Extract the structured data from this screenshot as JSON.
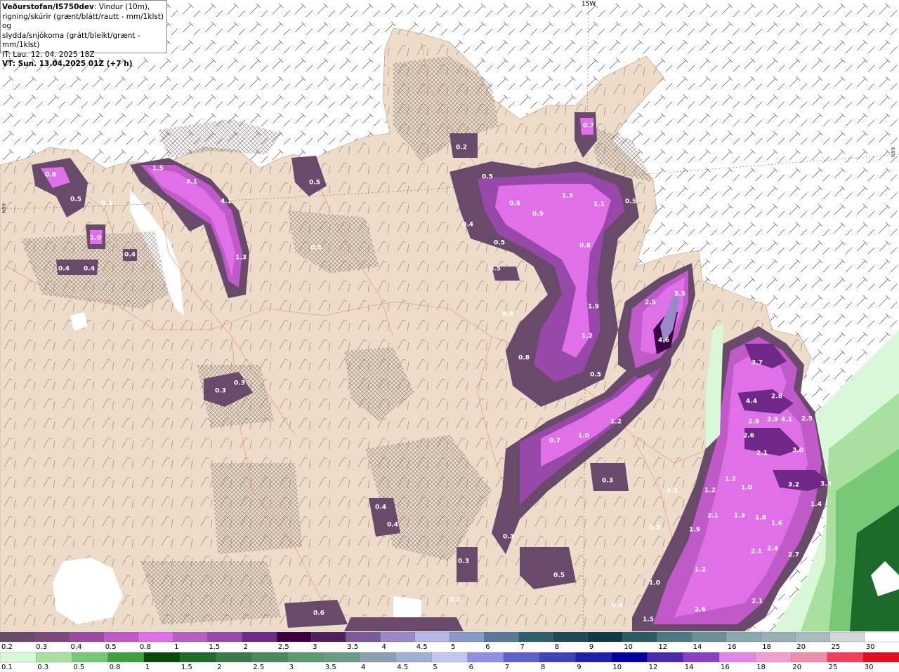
{
  "header": {
    "org": "Veðurstofan/IS750dev",
    "description_l1": ": Vindur (10m),",
    "description_l2": "rigning/skúrir (grænt/blátt/rautt - mm/1klst) og",
    "description_l3": "slydda/snjókoma (grátt/bleikt/grænt - mm/1klst)",
    "init_time": "IT: Lau. 12. 04. 2025 18Z",
    "valid_time": "VT: Sun. 13.04.2025 01Z (+7 h)"
  },
  "grid_labels": {
    "lon_15w": "15W",
    "lat_66n_left": "N99",
    "lat_66n_right": "N99"
  },
  "precip_labels": [
    {
      "text": "0.8"
    },
    {
      "text": "0.5"
    },
    {
      "text": "0.4"
    },
    {
      "text": "1.0"
    },
    {
      "text": "0.4"
    },
    {
      "text": "0.4"
    },
    {
      "text": "0.4"
    },
    {
      "text": "1.5"
    },
    {
      "text": "3.1"
    },
    {
      "text": "4.1"
    },
    {
      "text": "1.3"
    },
    {
      "text": "0.5"
    },
    {
      "text": "0.5"
    },
    {
      "text": "0.3"
    },
    {
      "text": "0.3"
    },
    {
      "text": "0.2"
    },
    {
      "text": "0.7"
    },
    {
      "text": "0.5"
    },
    {
      "text": "0.5"
    },
    {
      "text": "0.9"
    },
    {
      "text": "1.3"
    },
    {
      "text": "1.1"
    },
    {
      "text": "0.5"
    },
    {
      "text": "0.4"
    },
    {
      "text": "0.5"
    },
    {
      "text": "0.8"
    },
    {
      "text": "0.5"
    },
    {
      "text": "1.9"
    },
    {
      "text": "0.4"
    },
    {
      "text": "1.2"
    },
    {
      "text": "0.8"
    },
    {
      "text": "0.5"
    },
    {
      "text": "2.5"
    },
    {
      "text": "5.5"
    },
    {
      "text": "4.6"
    },
    {
      "text": "1.2"
    },
    {
      "text": "0.7"
    },
    {
      "text": "1.0"
    },
    {
      "text": "3.7"
    },
    {
      "text": "4.4"
    },
    {
      "text": "2.8"
    },
    {
      "text": "2.9"
    },
    {
      "text": "3.9"
    },
    {
      "text": "4.1"
    },
    {
      "text": "2.5"
    },
    {
      "text": "2.6"
    },
    {
      "text": "2.1"
    },
    {
      "text": "3.0"
    },
    {
      "text": "1.2"
    },
    {
      "text": "1.0"
    },
    {
      "text": "3.2"
    },
    {
      "text": "3.3"
    },
    {
      "text": "1.4"
    },
    {
      "text": "0.3"
    },
    {
      "text": "0.3"
    },
    {
      "text": "1.2"
    },
    {
      "text": "2.1"
    },
    {
      "text": "1.3"
    },
    {
      "text": "1.8"
    },
    {
      "text": "1.6"
    },
    {
      "text": "1.9"
    },
    {
      "text": "2.1"
    },
    {
      "text": "2.4"
    },
    {
      "text": "2.7"
    },
    {
      "text": "0.4"
    },
    {
      "text": "0.4"
    },
    {
      "text": "0.3"
    },
    {
      "text": "0.3"
    },
    {
      "text": "0.5"
    },
    {
      "text": "1.2"
    },
    {
      "text": "1.0"
    },
    {
      "text": "2.1"
    },
    {
      "text": "0.2"
    },
    {
      "text": "0.4"
    },
    {
      "text": "2.6"
    },
    {
      "text": "1.5"
    },
    {
      "text": "0.6"
    },
    {
      "text": "0.3"
    }
  ],
  "legend": {
    "snow_scale": {
      "labels": [
        "0.2",
        "0.3",
        "0.4",
        "0.5",
        "0.8",
        "1",
        "1.5",
        "2",
        "2.5",
        "3",
        "3.5",
        "4",
        "4.5",
        "5",
        "6",
        "7",
        "8",
        "9",
        "10",
        "12",
        "14",
        "16",
        "18",
        "20",
        "25",
        "30"
      ],
      "colors": [
        "#6a4a6a",
        "#7a4a7a",
        "#9a4aa0",
        "#c05ac8",
        "#e070e8",
        "#b860c0",
        "#9848a8",
        "#702888",
        "#3a0040",
        "#50205a",
        "#7a5a9a",
        "#9a88c8",
        "#b8b8e8",
        "#8898c8",
        "#5a7898",
        "#2f5f6a",
        "#1f4a55",
        "#0f3a45",
        "#2a5a62",
        "#4a7a80",
        "#6a9098",
        "#8aa8b0",
        "#98b0b5",
        "#a8bcc0",
        "#d0d8da",
        "#ffffff"
      ]
    },
    "rain_scale": {
      "labels": [
        "0.1",
        "0.3",
        "0.5",
        "0.8",
        "1",
        "1.5",
        "2",
        "2.5",
        "3",
        "3.5",
        "4",
        "4.5",
        "5",
        "6",
        "7",
        "8",
        "9",
        "10",
        "12",
        "14",
        "16",
        "18",
        "20",
        "25",
        "30"
      ],
      "colors": [
        "#d8f8d8",
        "#a8e0a0",
        "#78c878",
        "#40a040",
        "#0a4a0a",
        "#1e6a2a",
        "#3a7a48",
        "#4a8a5a",
        "#5a9a70",
        "#6a9a88",
        "#8aa0b0",
        "#a0b0d0",
        "#c0c8f0",
        "#9090e0",
        "#6060c8",
        "#4040b8",
        "#2020a8",
        "#0000a0",
        "#4a2aa8",
        "#8a40c0",
        "#e088e8",
        "#f0a0d0",
        "#f090b0",
        "#f04060",
        "#e01020"
      ]
    }
  }
}
